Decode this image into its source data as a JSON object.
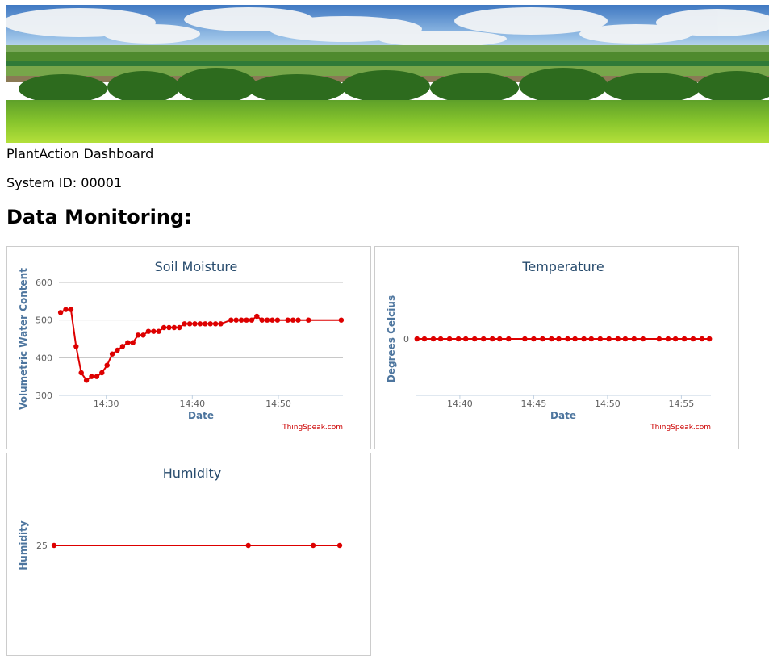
{
  "header": {
    "title": "PlantAction Dashboard",
    "system_id": "System ID: 00001",
    "section_heading": "Data Monitoring:"
  },
  "colors": {
    "series": "#dd0000",
    "title": "#274b6d",
    "axis_title": "#4d759e",
    "credit": "#cc0000"
  },
  "chart_data": [
    {
      "type": "line",
      "title": "Soil Moisture",
      "ylabel": "Volumetric Water Content",
      "xlabel": "Date",
      "credit": "ThingSpeak.com",
      "grid": true,
      "ylim": [
        300,
        600
      ],
      "yticks": [
        300,
        400,
        500,
        600
      ],
      "xlim_minutes": [
        "14:24.5",
        "14:57.5"
      ],
      "xticks": [
        "14:30",
        "14:40",
        "14:50"
      ],
      "series": [
        {
          "x": [
            "14:24.7",
            "14:25.3",
            "14:25.9",
            "14:26.5",
            "14:27.1",
            "14:27.7",
            "14:28.3",
            "14:28.9",
            "14:29.5",
            "14:30.1",
            "14:30.7",
            "14:31.3",
            "14:31.9",
            "14:32.5",
            "14:33.1",
            "14:33.7",
            "14:34.3",
            "14:34.9",
            "14:35.5",
            "14:36.1",
            "14:36.7",
            "14:37.3",
            "14:37.9",
            "14:38.5",
            "14:39.1",
            "14:39.7",
            "14:40.3",
            "14:40.9",
            "14:41.5",
            "14:42.1",
            "14:42.7",
            "14:43.3",
            "14:44.5",
            "14:45.1",
            "14:45.7",
            "14:46.3",
            "14:46.9",
            "14:47.5",
            "14:48.1",
            "14:48.7",
            "14:49.3",
            "14:49.9",
            "14:51.1",
            "14:51.7",
            "14:52.3",
            "14:53.5",
            "14:57.3"
          ],
          "values": [
            520,
            528,
            528,
            430,
            360,
            340,
            350,
            350,
            360,
            380,
            410,
            420,
            430,
            440,
            440,
            460,
            460,
            470,
            470,
            470,
            480,
            480,
            480,
            480,
            490,
            490,
            490,
            490,
            490,
            490,
            490,
            490,
            500,
            500,
            500,
            500,
            500,
            510,
            500,
            500,
            500,
            500,
            500,
            500,
            500,
            500,
            500
          ]
        }
      ]
    },
    {
      "type": "line",
      "title": "Temperature",
      "ylabel": "Degrees Celcius",
      "xlabel": "Date",
      "credit": "ThingSpeak.com",
      "grid": false,
      "yticks": [
        0
      ],
      "xlim_minutes": [
        "14:37.0",
        "14:57.0"
      ],
      "xticks": [
        "14:40",
        "14:45",
        "14:50",
        "14:55"
      ],
      "series": [
        {
          "x": [
            "14:37.1",
            "14:37.6",
            "14:38.2",
            "14:38.7",
            "14:39.3",
            "14:39.9",
            "14:40.4",
            "14:41.0",
            "14:41.6",
            "14:42.2",
            "14:42.7",
            "14:43.3",
            "14:44.4",
            "14:45.0",
            "14:45.6",
            "14:46.2",
            "14:46.7",
            "14:47.3",
            "14:47.8",
            "14:48.4",
            "14:48.9",
            "14:49.5",
            "14:50.1",
            "14:50.7",
            "14:51.2",
            "14:51.8",
            "14:52.4",
            "14:53.5",
            "14:54.1",
            "14:54.6",
            "14:55.2",
            "14:55.8",
            "14:56.4",
            "14:56.9"
          ],
          "values": [
            0,
            0,
            0,
            0,
            0,
            0,
            0,
            0,
            0,
            0,
            0,
            0,
            0,
            0,
            0,
            0,
            0,
            0,
            0,
            0,
            0,
            0,
            0,
            0,
            0,
            0,
            0,
            0,
            0,
            0,
            0,
            0,
            0,
            0
          ]
        }
      ]
    },
    {
      "type": "line",
      "title": "Humidity",
      "ylabel": "Humidity",
      "xlabel": "",
      "credit": "",
      "grid": false,
      "yticks": [
        25
      ],
      "series": [
        {
          "x": [
            0,
            0.68,
            0.907,
            1.0
          ],
          "values": [
            25,
            25,
            25,
            25
          ]
        }
      ]
    }
  ]
}
